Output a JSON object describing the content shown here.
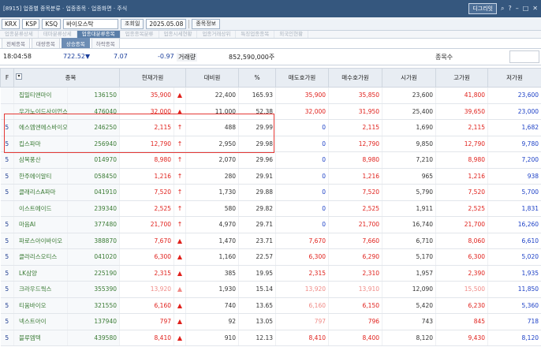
{
  "titlebar": {
    "title": "[8915] 업종별 종목분류 · 업종종목 · 업종화면 · 주식",
    "box_label": "디그리잇",
    "icons": [
      "search-icon",
      "help-icon",
      "minimize-icon",
      "maximize-icon",
      "close-icon"
    ],
    "icon_glyphs": [
      "⌕",
      "?",
      "–",
      "□",
      "✕"
    ]
  },
  "toolbar": {
    "market": "KRX",
    "market2": "KSP",
    "market3": "KSQ",
    "sector": "바이오스탁",
    "query_button": "조회일",
    "date": "2025.05.08",
    "list_button": "종목정보"
  },
  "category_tabs": [
    "업종분류상세",
    "테마분류상세",
    "업종대분류종목",
    "업종종목분류",
    "업종시세현황",
    "업종거래상위",
    "특징업종종목",
    "외국인현황"
  ],
  "category_active": 2,
  "sub_tabs": [
    "전체종목",
    "대량종목",
    "상승종목",
    "하락종목"
  ],
  "sub_active": 2,
  "summary": {
    "time": "18:04:58",
    "index_value": "722.52",
    "arrow": "▼",
    "change": "7.07",
    "rate": "-0.97",
    "volume_label": "거래량",
    "volume": "852,590,000주",
    "count_label": "종목수"
  },
  "columns": [
    "F",
    "종목",
    "",
    "현재가원",
    "",
    "대비원",
    "%",
    "매도호가원",
    "매수호가원",
    "시가원",
    "고가원",
    "저가원"
  ],
  "rows": [
    {
      "f": "",
      "name": "집밀티앤마이",
      "code": "136150",
      "price": "35,900",
      "sign": "▲",
      "diff": "22,400",
      "pct": "165.93",
      "ask": "35,900",
      "bid": "35,850",
      "open": "23,600",
      "high": "41,800",
      "low": "23,600",
      "color": "red",
      "ask_color": "red"
    },
    {
      "f": "",
      "name": "우가노이드사이언스",
      "code": "476040",
      "price": "32,000",
      "sign": "▲",
      "diff": "11,000",
      "pct": "52.38",
      "ask": "32,000",
      "bid": "31,950",
      "open": "25,400",
      "high": "39,650",
      "low": "23,000",
      "color": "red",
      "ask_color": "red"
    },
    {
      "f": "5",
      "name": "에스엠엔에스바이오",
      "code": "246250",
      "price": "2,115",
      "sign": "↑",
      "diff": "488",
      "pct": "29.99",
      "ask": "0",
      "bid": "2,115",
      "open": "1,690",
      "high": "2,115",
      "low": "1,682",
      "color": "red",
      "ask_color": "blue"
    },
    {
      "f": "5",
      "name": "킵스파마",
      "code": "256940",
      "price": "12,790",
      "sign": "↑",
      "diff": "2,950",
      "pct": "29.98",
      "ask": "0",
      "bid": "12,790",
      "open": "9,850",
      "high": "12,790",
      "low": "9,780",
      "color": "red",
      "ask_color": "blue"
    },
    {
      "f": "5",
      "name": "삼목풍산",
      "code": "014970",
      "price": "8,980",
      "sign": "↑",
      "diff": "2,070",
      "pct": "29.96",
      "ask": "0",
      "bid": "8,980",
      "open": "7,210",
      "high": "8,980",
      "low": "7,200",
      "color": "red",
      "ask_color": "blue"
    },
    {
      "f": "5",
      "name": "한주에이알티",
      "code": "058450",
      "price": "1,216",
      "sign": "↑",
      "diff": "280",
      "pct": "29.91",
      "ask": "0",
      "bid": "1,216",
      "open": "965",
      "high": "1,216",
      "low": "938",
      "color": "red",
      "ask_color": "blue"
    },
    {
      "f": "5",
      "name": "클래리스A파마",
      "code": "041910",
      "price": "7,520",
      "sign": "↑",
      "diff": "1,730",
      "pct": "29.88",
      "ask": "0",
      "bid": "7,520",
      "open": "5,790",
      "high": "7,520",
      "low": "5,700",
      "color": "red",
      "ask_color": "blue"
    },
    {
      "f": "",
      "name": "이스트에이드",
      "code": "239340",
      "price": "2,525",
      "sign": "↑",
      "diff": "580",
      "pct": "29.82",
      "ask": "0",
      "bid": "2,525",
      "open": "1,911",
      "high": "2,525",
      "low": "1,831",
      "color": "red",
      "ask_color": "blue"
    },
    {
      "f": "5",
      "name": "마음AI",
      "code": "377480",
      "price": "21,700",
      "sign": "↑",
      "diff": "4,970",
      "pct": "29.71",
      "ask": "0",
      "bid": "21,700",
      "open": "16,740",
      "high": "21,700",
      "low": "16,260",
      "color": "red",
      "ask_color": "blue"
    },
    {
      "f": "5",
      "name": "파로스아이바이오",
      "code": "388870",
      "price": "7,670",
      "sign": "▲",
      "diff": "1,470",
      "pct": "23.71",
      "ask": "7,670",
      "bid": "7,660",
      "open": "6,710",
      "high": "8,060",
      "low": "6,610",
      "color": "red",
      "ask_color": "red"
    },
    {
      "f": "5",
      "name": "클라리스오티스",
      "code": "041020",
      "price": "6,300",
      "sign": "▲",
      "diff": "1,160",
      "pct": "22.57",
      "ask": "6,300",
      "bid": "6,290",
      "open": "5,170",
      "high": "6,300",
      "low": "5,020",
      "color": "red",
      "ask_color": "red"
    },
    {
      "f": "5",
      "name": "LK삼양",
      "code": "225190",
      "price": "2,315",
      "sign": "▲",
      "diff": "385",
      "pct": "19.95",
      "ask": "2,315",
      "bid": "2,310",
      "open": "1,957",
      "high": "2,390",
      "low": "1,935",
      "color": "red",
      "ask_color": "red"
    },
    {
      "f": "5",
      "name": "크라우드웍스",
      "code": "355390",
      "price": "13,920",
      "sign": "▲",
      "diff": "1,930",
      "pct": "15.14",
      "ask": "13,920",
      "bid": "13,910",
      "open": "12,090",
      "high": "15,500",
      "low": "11,850",
      "color": "pale",
      "ask_color": "pale"
    },
    {
      "f": "5",
      "name": "티움바이오",
      "code": "321550",
      "price": "6,160",
      "sign": "▲",
      "diff": "740",
      "pct": "13.65",
      "ask": "6,160",
      "bid": "6,150",
      "open": "5,420",
      "high": "6,230",
      "low": "5,360",
      "color": "red",
      "ask_color": "pale"
    },
    {
      "f": "5",
      "name": "넥스트아이",
      "code": "137940",
      "price": "797",
      "sign": "▲",
      "diff": "92",
      "pct": "13.05",
      "ask": "797",
      "bid": "796",
      "open": "743",
      "high": "845",
      "low": "718",
      "color": "red",
      "ask_color": "pale"
    },
    {
      "f": "5",
      "name": "블루엠텍",
      "code": "439580",
      "price": "8,410",
      "sign": "▲",
      "diff": "910",
      "pct": "12.13",
      "ask": "8,410",
      "bid": "8,400",
      "open": "8,120",
      "high": "9,430",
      "low": "8,120",
      "color": "red",
      "ask_color": "red"
    }
  ]
}
